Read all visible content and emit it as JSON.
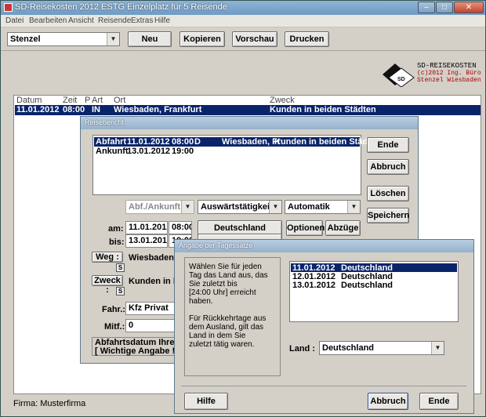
{
  "window": {
    "title": "SD-Reisekosten 2012 ESTG Einzelplatz für 5 Reisende",
    "controls": [
      "–",
      "□",
      "✕"
    ]
  },
  "menu": [
    "Datei",
    "Bearbeiten",
    "Ansicht",
    "Reisende",
    "Extras",
    "Hilfe"
  ],
  "toolbar": {
    "traveler": "Stenzel",
    "buttons": [
      "Neu",
      "Kopieren",
      "Vorschau",
      "Drucken"
    ]
  },
  "logo": {
    "badge": "SD",
    "line1": "SD-REISEKOSTEN",
    "line2": "(c)2012 Ing. Büro",
    "line3": "Stenzel Wiesbaden"
  },
  "list": {
    "headers": [
      "Datum",
      "Zeit",
      "P",
      "Art",
      "Ort",
      "Zweck"
    ],
    "row": {
      "datum": "11.01.2012",
      "zeit": "08:00",
      "art": "IN",
      "ort": "Wiesbaden, Frankfurt",
      "zweck": "Kunden in beiden Städten"
    }
  },
  "status": {
    "firma": "Firma: Musterfirma"
  },
  "reisebericht": {
    "title": "Reisebericht",
    "rows": [
      {
        "art": "Abfahrt",
        "datum": "11.01.2012",
        "zeit": "08:00",
        "kz": "D",
        "ort": "Wiesbaden, Fr",
        "zweck": "Kunden in beiden Städten"
      },
      {
        "art": "Ankunft",
        "datum": "13.01.2012",
        "zeit": "19:00",
        "kz": "",
        "ort": "",
        "zweck": ""
      }
    ],
    "side_buttons": [
      "Ende",
      "Abbruch",
      "Löschen",
      "Speichern"
    ],
    "combo_abf": "Abf./Ankunft",
    "combo_taet": "Auswärtstätigkeit",
    "combo_auto": "Automatik",
    "am_label": "am:",
    "am_date": "11.01.2012",
    "am_time": "08:00",
    "bis_label": "bis:",
    "bis_date": "13.01.2012",
    "bis_time": "19:00",
    "land_button": "Deutschland",
    "optionen_button": "Optionen",
    "abzuege_button": "Abzüge",
    "weg_button": "Weg :",
    "weg_value": "Wiesbaden, F",
    "zweck_button": "Zweck :",
    "zweck_value": "Kunden in bei",
    "s_label": "S",
    "fahr_label": "Fahr.:",
    "fahr_value": "Kfz Privat",
    "mitf_label": "Mitf.:",
    "mitf_value": "0",
    "hint1": "Abfahrtsdatum Ihrer Re",
    "hint2": "[ Wichtige Angabe ! ]"
  },
  "tagessaetze": {
    "title": "Angabe der Tagessätze",
    "instructions": [
      "Wählen Sie für jeden",
      "Tag das Land aus, das",
      "Sie zuletzt bis",
      "[24:00 Uhr] erreicht",
      "haben.",
      "",
      "Für Rückkehrtage aus",
      "dem Ausland, gilt das",
      "Land in dem Sie",
      "zuletzt tätig waren."
    ],
    "rows": [
      {
        "datum": "11.01.2012",
        "land": "Deutschland"
      },
      {
        "datum": "12.01.2012",
        "land": "Deutschland"
      },
      {
        "datum": "13.01.2012",
        "land": "Deutschland"
      }
    ],
    "land_label": "Land :",
    "land_value": "Deutschland",
    "buttons": {
      "hilfe": "Hilfe",
      "abbruch": "Abbruch",
      "ende": "Ende"
    }
  }
}
